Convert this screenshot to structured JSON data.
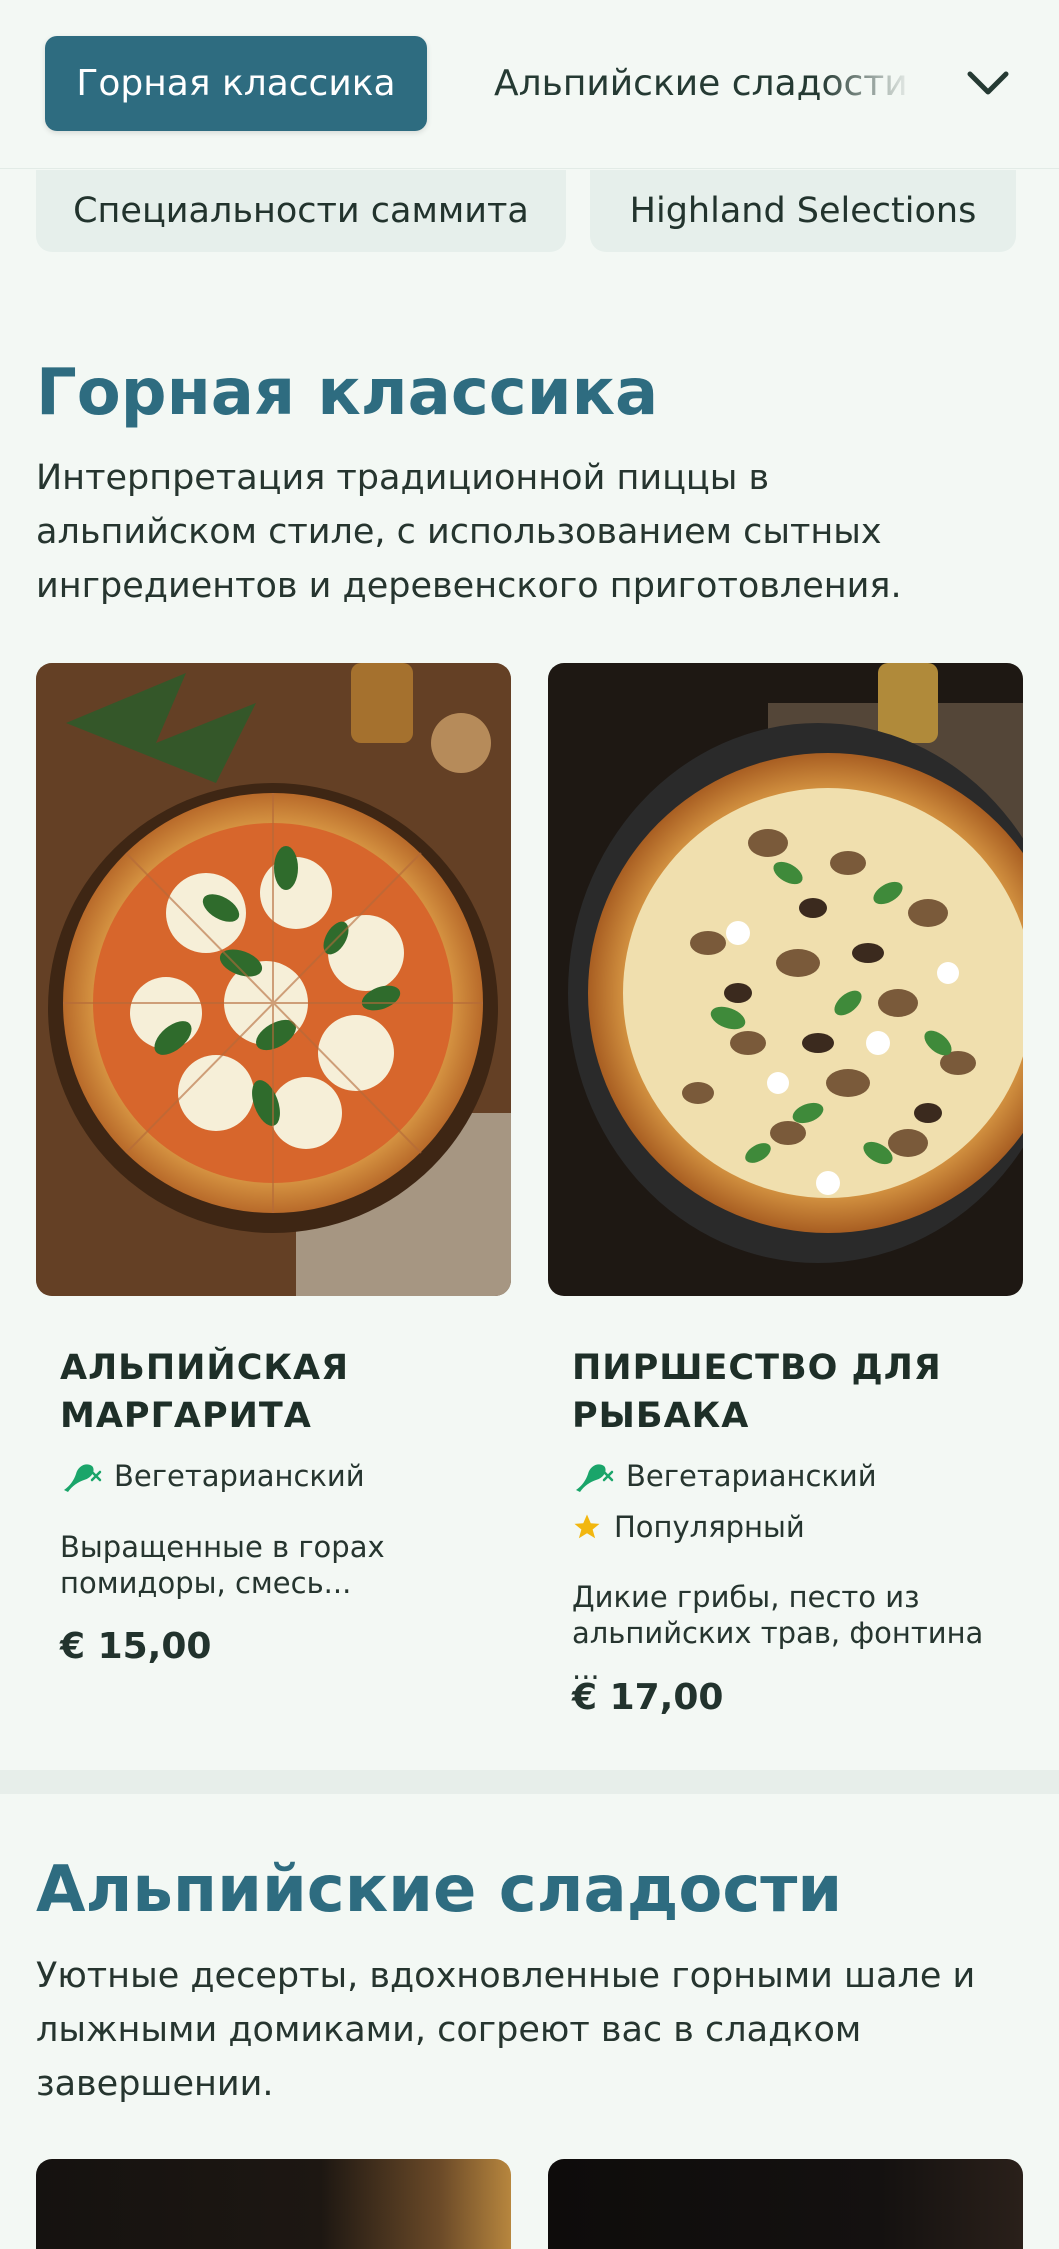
{
  "nav": {
    "active_tab": "Горная классика",
    "next_tab": "Альпийские сладости",
    "chips": [
      "Специальности саммита",
      "Highland Selections"
    ],
    "expand_icon": "chevron-down-icon"
  },
  "sections": [
    {
      "title": "Горная классика",
      "description": "Интерпретация традиционной пиццы в альпийском стиле, с использованием сытных ингредиентов и деревенского приготовления.",
      "items": [
        {
          "name": "АЛЬПИЙСКАЯ МАРГАРИТА",
          "tags": [
            {
              "label": "Вегетарианский",
              "icon": "vegetarian-icon"
            }
          ],
          "description": "Выращенные в горах помидоры, смесь...",
          "price": "€ 15,00"
        },
        {
          "name": "ПИРШЕСТВО ДЛЯ РЫБАКА",
          "tags": [
            {
              "label": "Вегетарианский",
              "icon": "vegetarian-icon"
            },
            {
              "label": "Популярный",
              "icon": "star-icon"
            }
          ],
          "description": "Дикие грибы, песто из альпийских трав, фонтина ...",
          "price": "€ 17,00"
        }
      ]
    },
    {
      "title": "Альпийские сладости",
      "description": "Уютные десерты, вдохновленные горными шале и лыжными домиками, согреют вас в сладком завершении."
    }
  ],
  "colors": {
    "accent": "#2e6c80",
    "background": "#f3f8f4",
    "vegetarian_green": "#1aa56a",
    "star_yellow": "#f2b70f"
  }
}
